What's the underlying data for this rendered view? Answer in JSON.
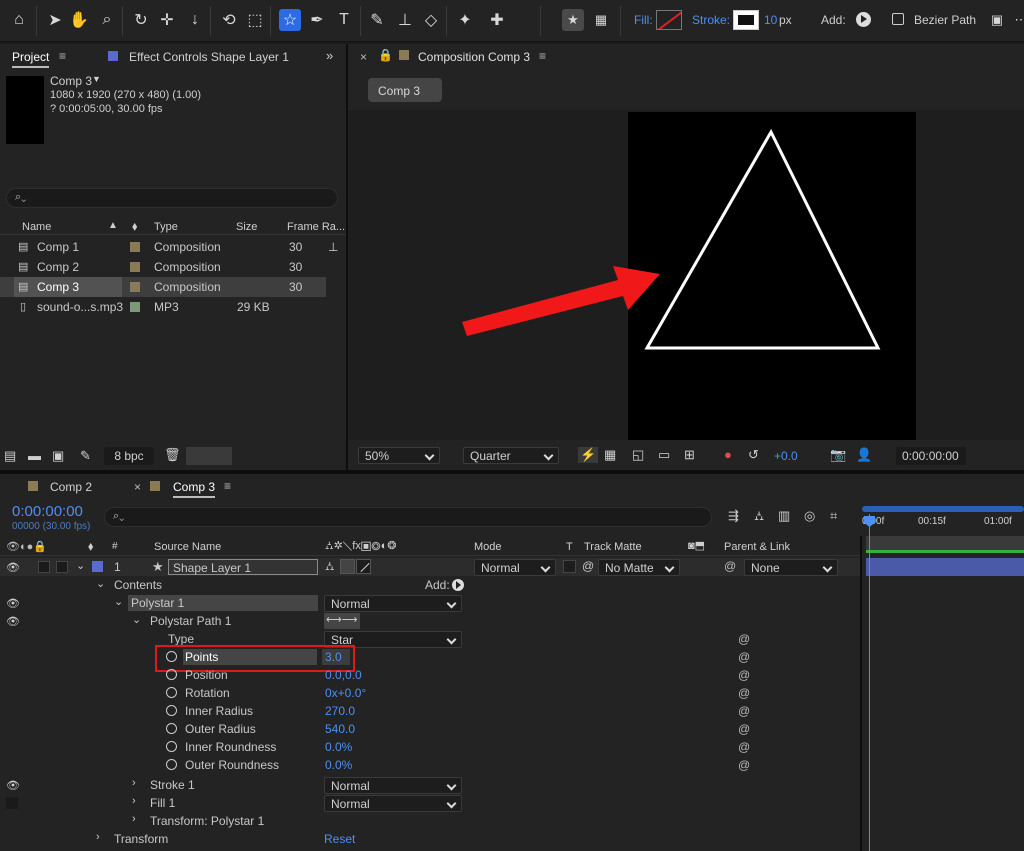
{
  "toolbar": {
    "tool_icons": [
      "home-icon",
      "selection-icon",
      "hand-icon",
      "zoom-icon",
      "orbit-icon",
      "pan-behind-icon",
      "anchor-down-icon",
      "rotate-icon",
      "region-icon",
      "star-tool-icon",
      "pen-icon",
      "type-icon",
      "brush-icon",
      "clone-stamp-icon",
      "eraser-icon",
      "roto-brush-icon",
      "puppet-icon"
    ],
    "fill_label": "Fill:",
    "stroke_label": "Stroke:",
    "stroke_width": "10",
    "stroke_unit": "px",
    "add_label": "Add:",
    "bezier_label": "Bezier Path",
    "accent_color": "#2d6be4",
    "value_color": "#4d8ff5"
  },
  "project_panel": {
    "tabs": [
      "Project",
      "Effect Controls Shape Layer 1"
    ],
    "comp_name": "Comp 3",
    "comp_size": "1080 x 1920  (270 x 480) (1.00)",
    "comp_duration": "? 0:00:05:00, 30.00 fps",
    "search_placeholder": "",
    "columns": [
      "Name",
      "Type",
      "Size",
      "Frame Ra..."
    ],
    "items": [
      {
        "name": "Comp 1",
        "type": "Composition",
        "size": "",
        "fps": "30",
        "color": "#8a7a55"
      },
      {
        "name": "Comp 2",
        "type": "Composition",
        "size": "",
        "fps": "30",
        "color": "#8a7a55"
      },
      {
        "name": "Comp 3",
        "type": "Composition",
        "size": "",
        "fps": "30",
        "color": "#8a7a55"
      },
      {
        "name": "sound-o...s.mp3",
        "type": "MP3",
        "size": "29 KB",
        "fps": "",
        "color": "#7a9a7a"
      }
    ],
    "bpc": "8 bpc"
  },
  "comp_panel": {
    "tab": "Composition Comp 3",
    "breadcrumb": "Comp 3",
    "zoom": "50%",
    "resolution": "Quarter",
    "exposure": "+0.0",
    "timecode": "0:00:00:00"
  },
  "timeline": {
    "tabs": [
      "Comp 2",
      "Comp 3"
    ],
    "timecode": "0:00:00:00",
    "frame_info": "00000 (30.00 fps)",
    "ruler_labels": [
      "0:00f",
      "00:15f",
      "01:00f"
    ],
    "col_source": "Source Name",
    "col_mode": "Mode",
    "col_t": "T",
    "col_track": "Track Matte",
    "col_parent": "Parent & Link",
    "layer": {
      "num": "1",
      "name": "Shape Layer 1",
      "mode": "Normal",
      "matte": "No Matte",
      "parent": "None"
    },
    "contents": "Contents",
    "add": "Add:",
    "polystar": {
      "name": "Polystar 1",
      "mode": "Normal"
    },
    "path": "Polystar Path 1",
    "props": [
      {
        "label": "Type",
        "value": "Star"
      },
      {
        "label": "Points",
        "value": "3.0"
      },
      {
        "label": "Position",
        "value": "0.0,0.0"
      },
      {
        "label": "Rotation",
        "value": "0x+0.0°"
      },
      {
        "label": "Inner Radius",
        "value": "270.0"
      },
      {
        "label": "Outer Radius",
        "value": "540.0"
      },
      {
        "label": "Inner Roundness",
        "value": "0.0%"
      },
      {
        "label": "Outer Roundness",
        "value": "0.0%"
      }
    ],
    "stroke": {
      "name": "Stroke 1",
      "mode": "Normal"
    },
    "fill": {
      "name": "Fill 1",
      "mode": "Normal"
    },
    "transform_poly": "Transform: Polystar 1",
    "transform": "Transform",
    "reset": "Reset"
  }
}
